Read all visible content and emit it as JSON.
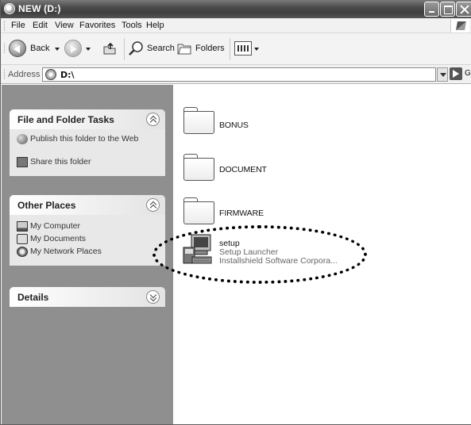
{
  "window": {
    "title": "NEW (D:)"
  },
  "menu": [
    "File",
    "Edit",
    "View",
    "Favorites",
    "Tools",
    "Help"
  ],
  "toolbar": {
    "back_label": "Back",
    "search_label": "Search",
    "folders_label": "Folders"
  },
  "address": {
    "label": "Address",
    "value": "D:\\",
    "go_label": "Go"
  },
  "tasks_panel": {
    "title": "File and Folder Tasks",
    "items": [
      "Publish this folder to the Web",
      "Share this folder"
    ]
  },
  "places_panel": {
    "title": "Other Places",
    "items": [
      "My Computer",
      "My Documents",
      "My Network Places"
    ]
  },
  "details_panel": {
    "title": "Details"
  },
  "files": {
    "folders": [
      "BONUS",
      "DOCUMENT",
      "FIRMWARE"
    ],
    "setup": {
      "name": "setup",
      "description": "Setup Launcher",
      "company": "Installshield Software Corpora..."
    }
  }
}
